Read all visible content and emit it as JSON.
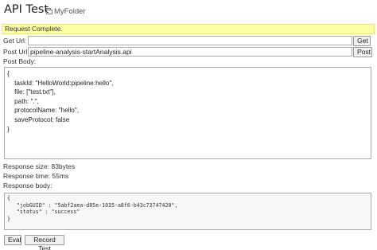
{
  "header": {
    "title": "API Test",
    "folder": "MyFolder",
    "folder_icon": "folder-icon"
  },
  "status": {
    "message": "Request Complete.",
    "color": "#ffffa6"
  },
  "get": {
    "label": "Get Url:",
    "value": "",
    "button": "Get"
  },
  "post": {
    "label": "Post Url:",
    "value": "pipeline-analysis-startAnalysis.api",
    "button": "Post"
  },
  "body": {
    "label": "Post Body:",
    "text": "{\n    taskId: \"HelloWorld:pipeline:hello\",\n    file: [\"test.txt\"],\n    path: \".\",\n    protocolName: \"hello\",\n    saveProtocol: false\n}"
  },
  "response": {
    "size": "Response size: 83bytes",
    "time": "Response time: 55ms",
    "body_label": "Response body:",
    "body": "{\n   \"jobGUID\" : \"5abf2aea-d85e-1035-a8f6-b43c73747420\",\n   \"status\" : \"success\"\n}"
  },
  "footer": {
    "eval": "Eval",
    "record": "Record Test"
  }
}
